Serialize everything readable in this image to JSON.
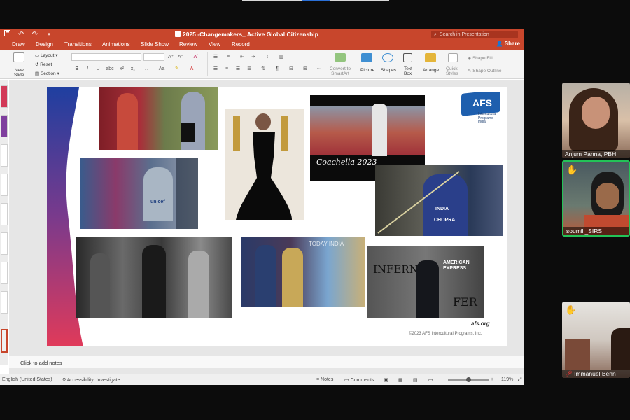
{
  "window": {
    "doc_title": "2025 -Changemakers_ Active Global Citizenship",
    "search_placeholder": "Search in Presentation",
    "share_label": "Share"
  },
  "tabs": [
    "Draw",
    "Design",
    "Transitions",
    "Animations",
    "Slide Show",
    "Review",
    "View",
    "Record"
  ],
  "ribbon": {
    "new_slide": "New\nSlide",
    "layout": "Layout",
    "reset": "Reset",
    "section": "Section",
    "font_size_placeholder": "",
    "convert_to_smartart": "Convert to\nSmartArt",
    "picture": "Picture",
    "shapes": "Shapes",
    "text_box": "Text\nBox",
    "arrange": "Arrange",
    "quick_styles": "Quick\nStyles",
    "shape_fill": "Shape Fill",
    "shape_outline": "Shape Outline"
  },
  "slide": {
    "coachella_caption": "Coachella 2023",
    "afs_logo": "AFS",
    "afs_sub": "Intercultural\nPrograms\nIndia",
    "footer_site": "afs.org",
    "footer_copyright": "©2023 AFS Intercultural Programs, Inc.",
    "jersey_text": "INDIA",
    "jersey_name": "CHOPRA",
    "banner_inferno": "INFERNO",
    "banner_amex": "AMERICAN\nEXPRESS",
    "banner_fer": "FER",
    "today_india": "TODAY INDIA",
    "unicef_text": "unicef"
  },
  "notes": {
    "placeholder": "Click to add notes"
  },
  "status": {
    "language": "English (United States)",
    "accessibility": "Accessibility: Investigate",
    "notes": "Notes",
    "comments": "Comments",
    "zoom": "119%"
  },
  "participants": [
    {
      "name": "Anjum Panna, PBH",
      "hand": false
    },
    {
      "name": "soumili_SIRS",
      "hand": true
    },
    {
      "name": "Immanuel Benn",
      "hand": true
    }
  ],
  "colors": {
    "ppt_accent": "#c8462c",
    "afs_blue": "#1e5fae",
    "gradient_top": "#1f3fa0",
    "gradient_bottom": "#e03a5a"
  }
}
